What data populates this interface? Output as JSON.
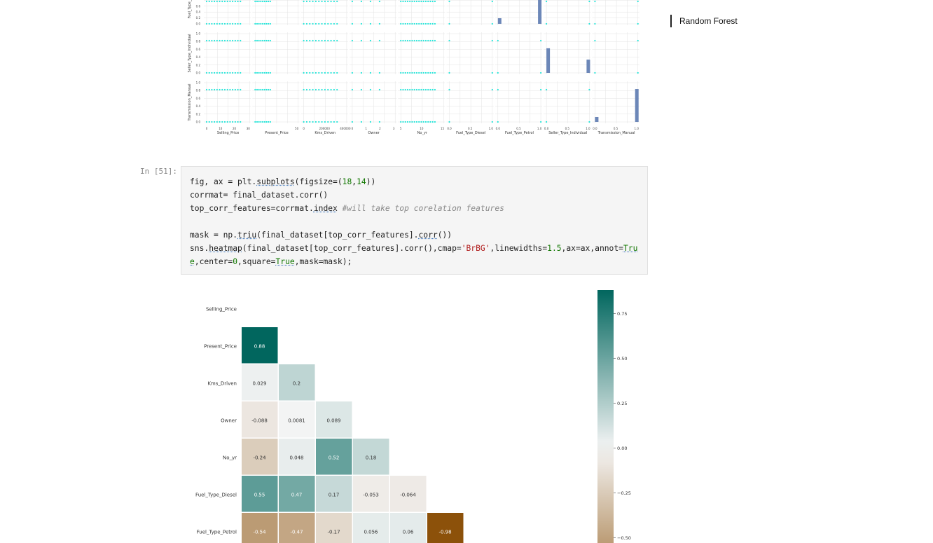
{
  "toc": {
    "active_item": "Random Forest"
  },
  "cell": {
    "prompt": "In [51]:",
    "code_lines": [
      "fig, ax = plt.subplots(figsize=(18,14))",
      "corrmat= final_dataset.corr()",
      "top_corr_features=corrmat.index #will take top corelation features",
      "",
      "mask = np.triu(final_dataset[top_corr_features].corr())",
      "sns.heatmap(final_dataset[top_corr_features].corr(),cmap='BrBG',linewidths=1.5,ax=ax,annot=Tru",
      "e,center=0,square=True,mask=mask);"
    ]
  },
  "colors": {
    "scatter_point": "#27e6da",
    "hist_bar": "#6c87b8",
    "grid": "#e3e3e3",
    "code_bg": "#f5f5f5",
    "heatmap_low": "#8c510a",
    "heatmap_mid": "#f5f5f5",
    "heatmap_high": "#01665e"
  },
  "chart_data": [
    {
      "type": "scatter",
      "title": "",
      "x_labels": [
        "Selling_Price",
        "Present_Price",
        "Kms_Driven",
        "Owner",
        "No_yr",
        "Fuel_Type_Diesel",
        "Fuel_Type_Petrol",
        "Seller_Type_Individual",
        "Transmission_Manual"
      ],
      "visible_y_labels": [
        "Fuel_Type_",
        "Seller_Type_Individual",
        "Transmission_Manual"
      ],
      "x_ticks": [
        [
          "0",
          "10",
          "20",
          "30"
        ],
        [
          "",
          "50"
        ],
        [
          "0",
          "200000",
          "400000"
        ],
        [
          "0",
          "1",
          "2",
          "3"
        ],
        [
          "5",
          "10",
          "15"
        ],
        [
          "0.0",
          "0.5",
          "1.0"
        ],
        [
          "0.0",
          "0.5",
          "1.0"
        ],
        [
          "0.0",
          "0.5",
          "1.0"
        ],
        [
          "0.0",
          "0.5",
          "1.0"
        ]
      ],
      "y_ticks": [
        "0.0",
        "0.2",
        "0.4",
        "0.6",
        "0.8",
        "1.0"
      ],
      "diagonal_histograms": [
        {
          "variable": "Fuel_Type_Petrol",
          "bars": [
            {
              "x": 0.0,
              "height": 0.2
            },
            {
              "x": 1.0,
              "height": 1.0
            }
          ]
        },
        {
          "variable": "Seller_Type_Individual",
          "bars": [
            {
              "x": 0.0,
              "height": 0.65
            },
            {
              "x": 1.0,
              "height": 0.35
            }
          ]
        },
        {
          "variable": "Transmission_Manual",
          "bars": [
            {
              "x": 0.0,
              "height": 0.13
            },
            {
              "x": 1.0,
              "height": 0.87
            }
          ]
        }
      ]
    },
    {
      "type": "heatmap",
      "title": "",
      "y_labels": [
        "Selling_Price",
        "Present_Price",
        "Kms_Driven",
        "Owner",
        "No_yr",
        "Fuel_Type_Diesel",
        "Fuel_Type_Petrol"
      ],
      "values": [
        [],
        [
          0.88
        ],
        [
          0.029,
          0.2
        ],
        [
          -0.088,
          0.0081,
          0.089
        ],
        [
          -0.24,
          0.048,
          0.52,
          0.18
        ],
        [
          0.55,
          0.47,
          0.17,
          -0.053,
          -0.064
        ],
        [
          -0.54,
          -0.47,
          -0.17,
          0.056,
          0.06,
          -0.98
        ]
      ],
      "annotations": [
        [],
        [
          "0.88"
        ],
        [
          "0.029",
          "0.2"
        ],
        [
          "-0.088",
          "0.0081",
          "0.089"
        ],
        [
          "-0.24",
          "0.048",
          "0.52",
          "0.18"
        ],
        [
          "0.55",
          "0.47",
          "0.17",
          "-0.053",
          "-0.064"
        ],
        [
          "-0.54",
          "-0.47",
          "-0.17",
          "0.056",
          "0.06",
          "-0.98"
        ]
      ],
      "colormap": "BrBG",
      "center": 0,
      "colorbar_ticks": [
        0.75,
        0.5,
        0.25,
        0.0,
        -0.25,
        -0.5
      ],
      "colorbar_tick_labels": [
        "0.75",
        "0.50",
        "0.25",
        "0.00",
        "−0.25",
        "−0.50"
      ]
    }
  ]
}
